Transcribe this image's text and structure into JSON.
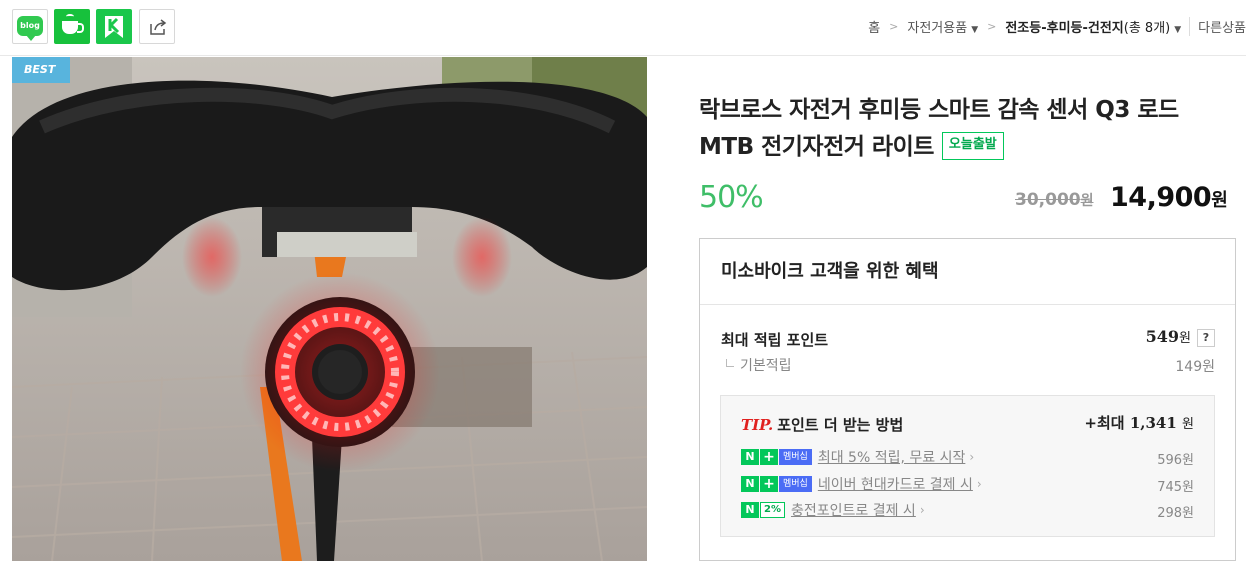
{
  "share_buttons": [
    {
      "name": "blog",
      "label": "blog"
    },
    {
      "name": "cafe",
      "label": ""
    },
    {
      "name": "keep",
      "label": ""
    },
    {
      "name": "share",
      "label": ""
    }
  ],
  "breadcrumb": {
    "home": "홈",
    "category": "자전거용품",
    "current": "전조등-후미등-건전지",
    "count": "(총 8개)",
    "other": "다른상품"
  },
  "photo": {
    "badge": "BEST",
    "alt": "자전거 안장 아래 장착된 원형 후미등"
  },
  "product": {
    "title": "락브로스 자전거 후미등 스마트 감속 센서 Q3 로드 MTB 전기자전거 라이트",
    "today_badge": "오늘출발",
    "discount": "50%",
    "original_price": "30,000",
    "sale_price": "14,900",
    "currency": "원"
  },
  "benefit": {
    "header": "미소바이크 고객을 위한 혜택",
    "max_points_label": "최대 적립 포인트",
    "max_points_value": "549",
    "help_label": "?",
    "basic_label": "기본적립",
    "basic_value": "149원",
    "tip": {
      "tip_label": "TIP.",
      "title": "포인트 더 받는 방법",
      "total_value": "+최대 1,341",
      "total_unit": "원",
      "rows": [
        {
          "n": "N",
          "plus": "+",
          "tag": "멤버십",
          "text": "최대 5% 적립, 무료 시작",
          "value": "596원"
        },
        {
          "n": "N",
          "plus": "+",
          "tag": "멤버십",
          "text": "네이버 현대카드로 결제 시",
          "value": "745원"
        },
        {
          "n": "N",
          "tag": "2%",
          "text": "충전포인트로 결제 시",
          "value": "298원"
        }
      ]
    }
  },
  "colors": {
    "naver_green": "#03c75a",
    "best_badge": "#58b4dd",
    "discount": "#3fbe68",
    "tip_red": "#e0201e",
    "membership_blue": "#4b6cf5"
  }
}
